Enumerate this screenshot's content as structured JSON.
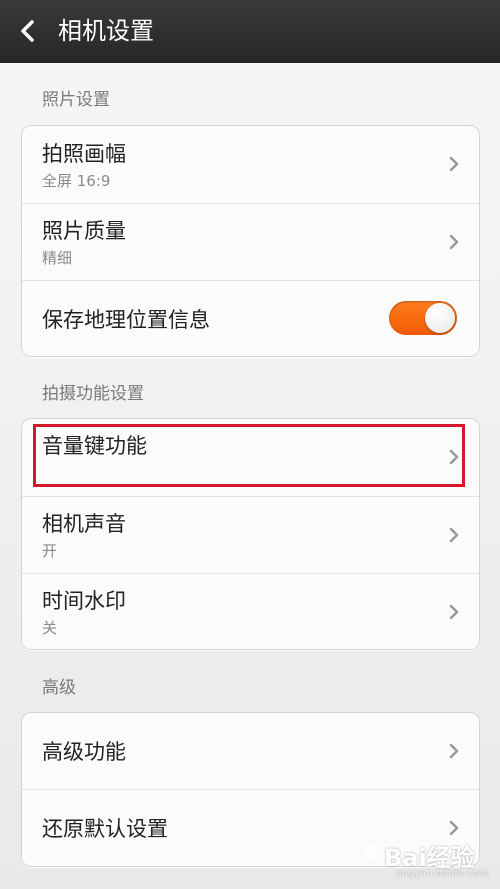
{
  "header": {
    "title": "相机设置"
  },
  "sections": [
    {
      "label": "照片设置",
      "items": [
        {
          "title": "拍照画幅",
          "subtitle": "全屏 16:9"
        },
        {
          "title": "照片质量",
          "subtitle": "精细"
        },
        {
          "title": "保存地理位置信息",
          "toggle": true
        }
      ]
    },
    {
      "label": "拍摄功能设置",
      "items": [
        {
          "title": "音量键功能"
        },
        {
          "title": "相机声音",
          "subtitle": "开"
        },
        {
          "title": "时间水印",
          "subtitle": "关"
        }
      ]
    },
    {
      "label": "高级",
      "items": [
        {
          "title": "高级功能"
        },
        {
          "title": "还原默认设置"
        }
      ]
    }
  ],
  "colors": {
    "accent_toggle": "#f26a0f",
    "highlight_box": "#d3182b",
    "header_bg": "#2f2f2f"
  },
  "watermark": {
    "main": "Bai经验",
    "sub": "jingyan.baidu.com"
  }
}
